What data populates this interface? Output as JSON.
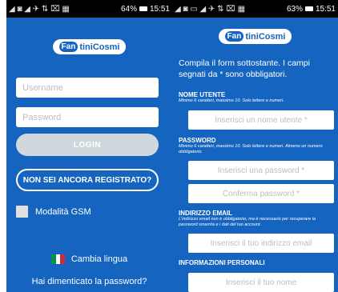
{
  "left": {
    "status": {
      "icons": "◢ ◙ ◢ ✈  ⇅ ⌧ ▦",
      "battery": "64%",
      "time": "15:51"
    },
    "logo": {
      "fan": "Fan",
      "rest": "tiniCosmi"
    },
    "username_placeholder": "Username",
    "password_placeholder": "Password",
    "login_label": "LOGIN",
    "register_label": "NON SEI ANCORA REGISTRATO?",
    "gsm_label": "Modalità GSM",
    "language_label": "Cambia lingua",
    "forgot_label": "Hai dimenticato la password?"
  },
  "right": {
    "status": {
      "icons": "◢ ◙ ▭ ◢ ✈  ⇅ ⌧ ▦",
      "battery": "63%",
      "time": "15:51"
    },
    "logo": {
      "fan": "Fan",
      "rest": "tiniCosmi"
    },
    "intro": "Compila il form sottostante. I campi segnati da * sono obbligatori.",
    "nome_title": "NOME UTENTE",
    "nome_hint": "Minimo 6 caratteri, massimo 10. Solo lettere e numeri.",
    "nome_placeholder": "Inserisci un nome utente *",
    "password_title": "PASSWORD",
    "password_hint": "Minimo 6 caratteri, massimo 10. Solo lettere e numeri. Almeno un numero obbligatorio.",
    "password_placeholder": "Inserisci una password *",
    "confirm_placeholder": "Conferma password *",
    "email_title": "INDIRIZZO EMAIL",
    "email_hint": "L'indirizzo email non è obbligatorio, ma è necessario per recuperare la password smarrita e i dati del tuo account.",
    "email_placeholder": "Inserisci il tuo indirizzo email",
    "info_title": "INFORMAZIONI PERSONALI",
    "name_placeholder": "Inserisci il tuo nome"
  },
  "colors": {
    "brand_blue": "#1565c0",
    "flag_green": "#009246",
    "flag_white": "#ffffff",
    "flag_red": "#ce2b37"
  }
}
